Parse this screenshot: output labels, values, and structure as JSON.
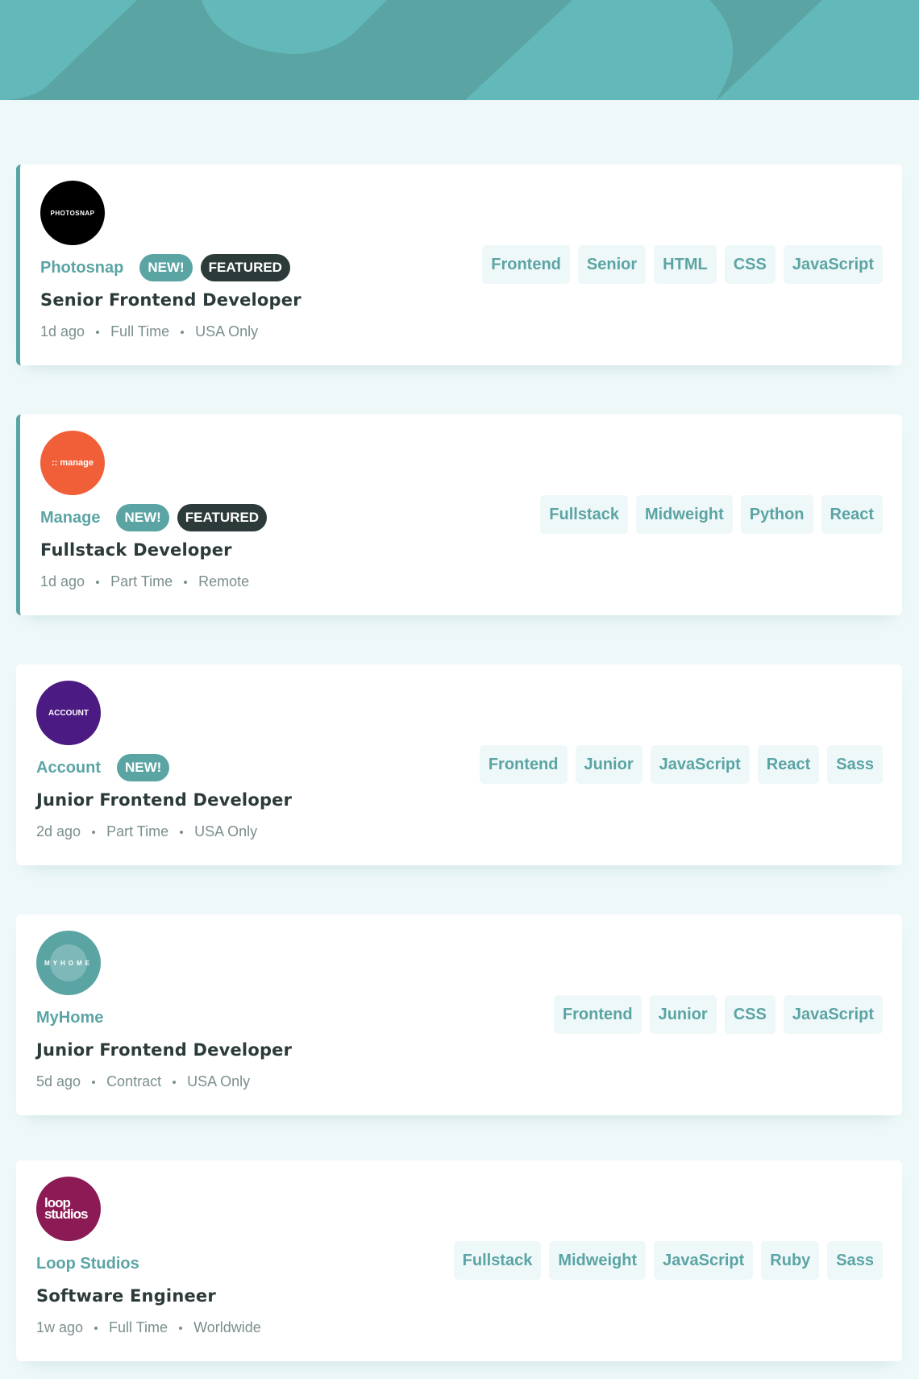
{
  "colors": {
    "primary": "#5ba4a4",
    "background": "#eff8f9",
    "filter_tag_bg": "#eff8f9",
    "dark": "#2c3a3a",
    "muted": "#7b8e8e"
  },
  "jobs": [
    {
      "company": "Photosnap",
      "logo_text": "PHOTOSNAP",
      "logo_color": "#000000",
      "new_label": "NEW!",
      "featured_label": "FEATURED",
      "position": "Senior Frontend Developer",
      "posted": "1d ago",
      "contract": "Full Time",
      "location": "USA Only",
      "tags": [
        "Frontend",
        "Senior",
        "HTML",
        "CSS",
        "JavaScript"
      ]
    },
    {
      "company": "Manage",
      "logo_text": ":: manage",
      "logo_color": "#f15f39",
      "new_label": "NEW!",
      "featured_label": "FEATURED",
      "position": "Fullstack Developer",
      "posted": "1d ago",
      "contract": "Part Time",
      "location": "Remote",
      "tags": [
        "Fullstack",
        "Midweight",
        "Python",
        "React"
      ]
    },
    {
      "company": "Account",
      "logo_text": "ACCOUNT",
      "logo_color": "#4b1a82",
      "new_label": "NEW!",
      "position": "Junior Frontend Developer",
      "posted": "2d ago",
      "contract": "Part Time",
      "location": "USA Only",
      "tags": [
        "Frontend",
        "Junior",
        "JavaScript",
        "React",
        "Sass"
      ]
    },
    {
      "company": "MyHome",
      "logo_text": "MYHOME",
      "logo_color": "#5ba4a4",
      "position": "Junior Frontend Developer",
      "posted": "5d ago",
      "contract": "Contract",
      "location": "USA Only",
      "tags": [
        "Frontend",
        "Junior",
        "CSS",
        "JavaScript"
      ]
    },
    {
      "company": "Loop Studios",
      "logo_text": "loop studios",
      "logo_color": "#8c1a54",
      "position": "Software Engineer",
      "posted": "1w ago",
      "contract": "Full Time",
      "location": "Worldwide",
      "tags": [
        "Fullstack",
        "Midweight",
        "JavaScript",
        "Ruby",
        "Sass"
      ]
    }
  ]
}
